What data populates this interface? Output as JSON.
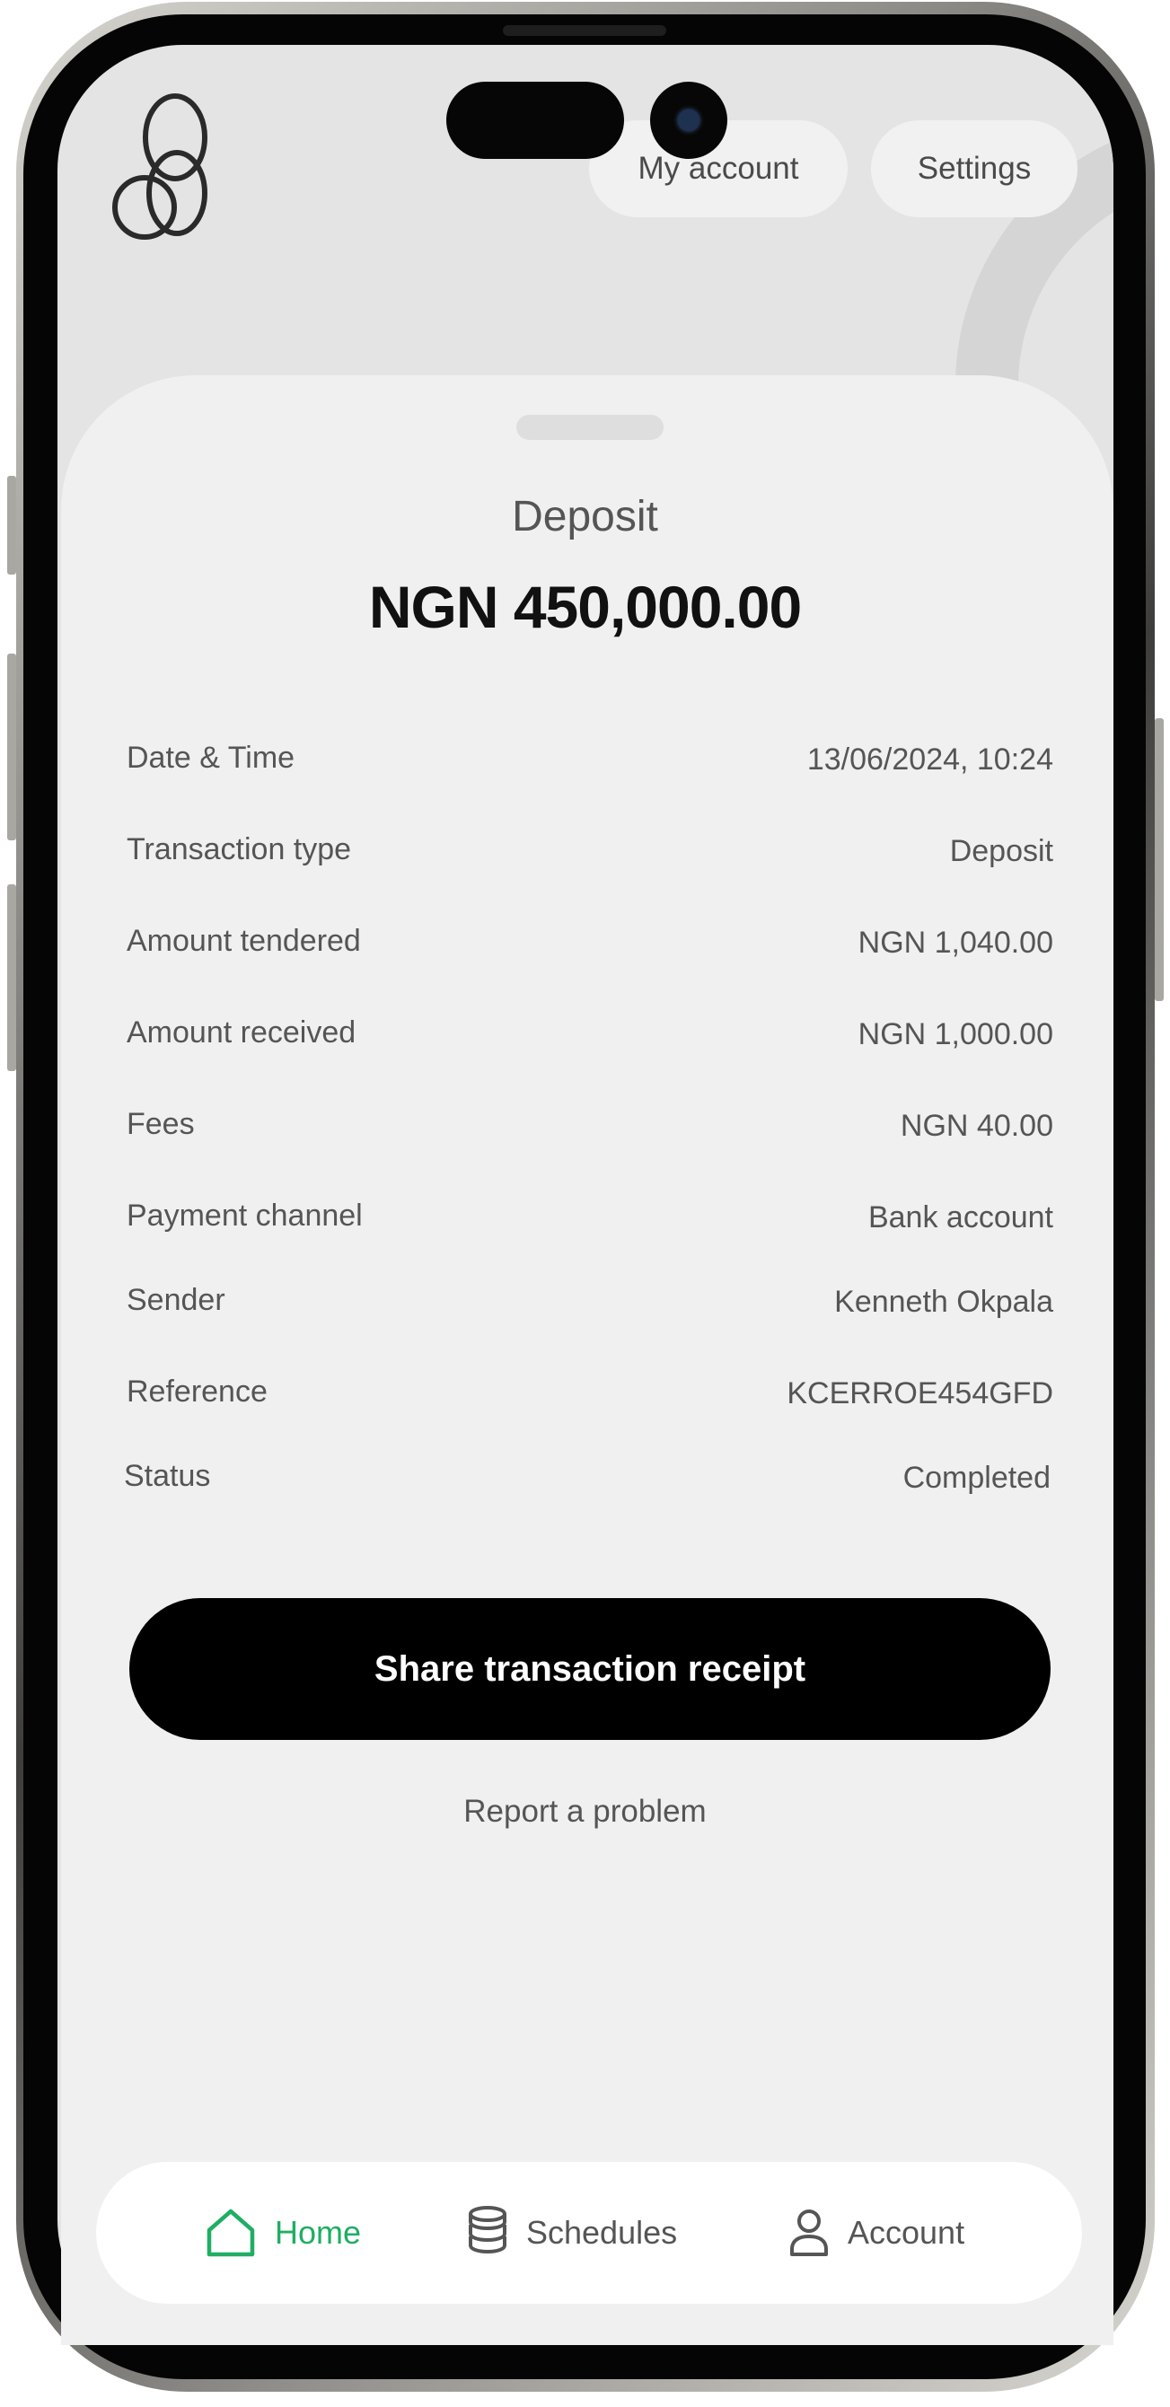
{
  "header": {
    "my_account_label": "My account",
    "settings_label": "Settings"
  },
  "transaction": {
    "type": "Deposit",
    "amount": "NGN 450,000.00",
    "details": [
      {
        "label": "Date & Time",
        "value": "13/06/2024, 10:24"
      },
      {
        "label": "Transaction type",
        "value": "Deposit"
      },
      {
        "label": "Amount tendered",
        "value": "NGN 1,040.00"
      },
      {
        "label": "Amount received",
        "value": "NGN 1,000.00"
      },
      {
        "label": "Fees",
        "value": "NGN 40.00"
      },
      {
        "label": "Payment channel",
        "value": "Bank account"
      },
      {
        "label": "Sender",
        "value": "Kenneth Okpala"
      },
      {
        "label": "Reference",
        "value": "KCERROE454GFD"
      },
      {
        "label": "Status",
        "value": "Completed"
      }
    ]
  },
  "actions": {
    "share_label": "Share transaction receipt",
    "report_label": "Report a problem"
  },
  "nav": {
    "items": [
      {
        "label": "Home",
        "icon": "home-icon",
        "active": true
      },
      {
        "label": "Schedules",
        "icon": "coins-stack-icon",
        "active": false
      },
      {
        "label": "Account",
        "icon": "user-icon",
        "active": false
      }
    ]
  },
  "colors": {
    "accent": "#1fae63",
    "primary_button": "#000000",
    "sheet_background": "#f0f0f0",
    "screen_background": "#e4e4e4"
  }
}
